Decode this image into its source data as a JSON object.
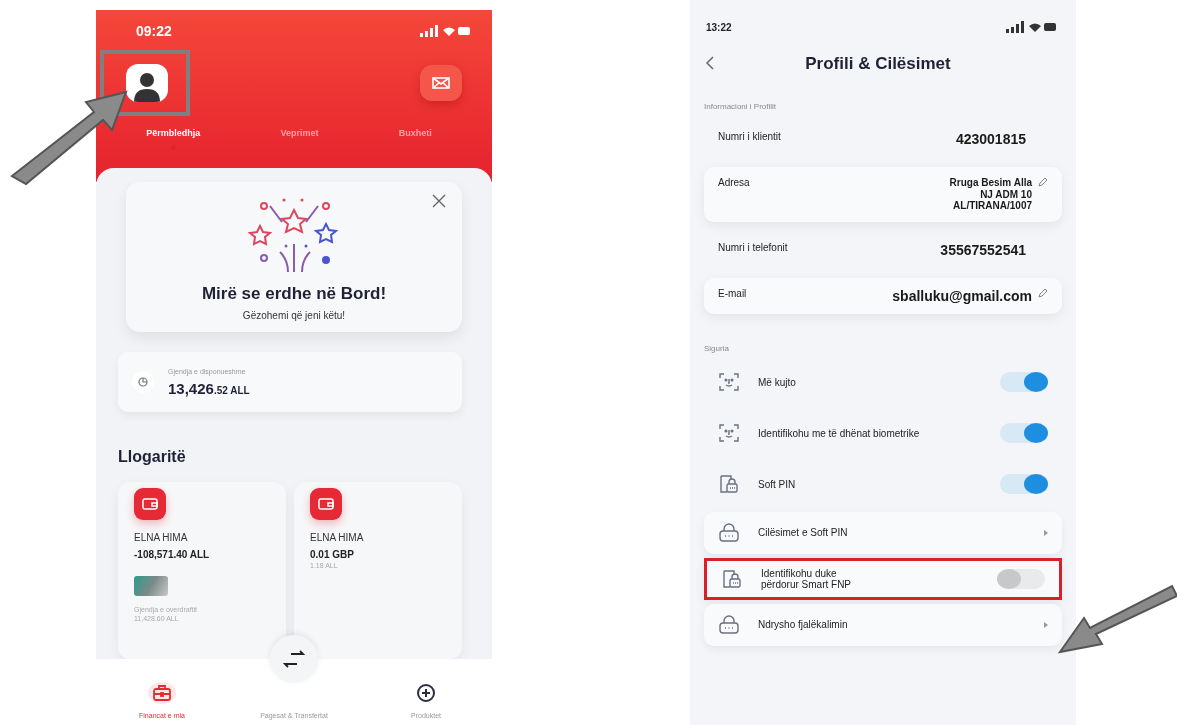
{
  "home_screen": {
    "status_bar": {
      "time": "09:22"
    },
    "avatar_highlighted": true,
    "tabs": [
      {
        "label": "Përmbledhja",
        "selected": true
      },
      {
        "label": "Veprimet",
        "selected": false
      },
      {
        "label": "Buxheti",
        "selected": false
      }
    ],
    "welcome_card": {
      "title": "Mirë se erdhe në Bord!",
      "subtitle": "Gëzohemi që jeni këtu!"
    },
    "balance": {
      "label": "Gjendja e disponueshme",
      "amount_main": "13,426",
      "amount_rest": ".52 ALL"
    },
    "accounts_heading": "Llogaritë",
    "accounts": [
      {
        "holder": "ELNA HIMA",
        "balance": "-108,571.40 ALL",
        "has_card": true,
        "details": [
          "Gjendja e overdraftit",
          "11,428.60 ALL"
        ]
      },
      {
        "holder": "ELNA HIMA",
        "balance": "0.01 GBP",
        "has_card": false,
        "details": [
          "1.18 ALL"
        ]
      }
    ],
    "bottom_nav": [
      {
        "label": "Financat e mia",
        "selected": true
      },
      {
        "label": "Pagesat & Transfertat",
        "selected": false
      },
      {
        "label": "Produktet",
        "selected": false
      }
    ]
  },
  "profile_screen": {
    "status_bar": {
      "time": "13:22"
    },
    "title": "Profili & Cilësimet",
    "info_heading": "Informacioni i Profilit",
    "info": [
      {
        "label": "Numri i klientit",
        "value": [
          "423001815"
        ],
        "editable": false
      },
      {
        "label": "Adresa",
        "value": [
          "Rruga Besim Alla",
          "NJ ADM 10",
          "AL/TIRANA/1007"
        ],
        "editable": true
      },
      {
        "label": "Numri i telefonit",
        "value": [
          "35567552541"
        ],
        "editable": false
      },
      {
        "label": "E-mail",
        "value": [
          "sballuku@gmail.com"
        ],
        "editable": true
      }
    ],
    "security_heading": "Siguria",
    "security": [
      {
        "kind": "toggle",
        "label": "Më kujto",
        "on": true,
        "highlighted": false
      },
      {
        "kind": "toggle",
        "label": "Identifikohu me të dhënat biometrike",
        "on": true,
        "highlighted": false
      },
      {
        "kind": "toggle",
        "label": "Soft PIN",
        "on": true,
        "highlighted": false
      },
      {
        "kind": "link",
        "label": "Cilësimet e Soft PIN",
        "highlighted": false
      },
      {
        "kind": "card_toggle",
        "label": "Identifikohu duke përdorur Smart FNP",
        "on": false,
        "highlighted": true
      },
      {
        "kind": "link",
        "label": "Ndrysho fjalëkalimin",
        "highlighted": false
      }
    ]
  }
}
